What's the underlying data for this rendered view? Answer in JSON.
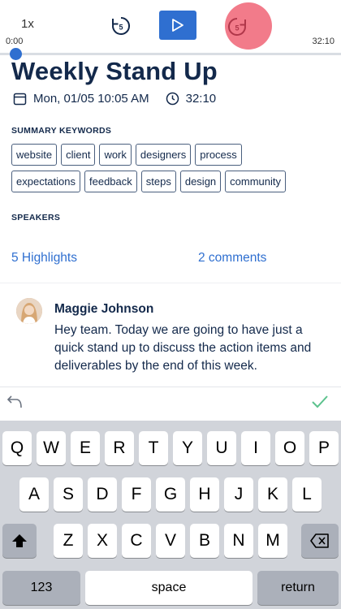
{
  "player": {
    "speed": "1x",
    "skip_back_seconds": "5",
    "skip_forward_seconds": "5",
    "current_time": "0:00",
    "total_time": "32:10",
    "progress": 0.0,
    "accent_color": "#2f6fd0",
    "highlight_color": "#f27b8a"
  },
  "meeting": {
    "title": "Weekly Stand Up",
    "date": "Mon, 01/05 10:05 AM",
    "duration": "32:10"
  },
  "keywords": {
    "label": "SUMMARY KEYWORDS",
    "row1": [
      "website",
      "client",
      "work",
      "designers",
      "process"
    ],
    "row2": [
      "expectations",
      "feedback",
      "steps",
      "design",
      "community"
    ]
  },
  "speakers": {
    "label": "SPEAKERS"
  },
  "stats": {
    "highlights": "5 Highlights",
    "comments": "2 comments"
  },
  "comment": {
    "author": "Maggie Johnson",
    "text": "Hey team. Today we are going to have just a quick stand up to discuss the action items and deliverables by the end of this week."
  },
  "keyboard": {
    "row1": [
      "Q",
      "W",
      "E",
      "R",
      "T",
      "Y",
      "U",
      "I",
      "O",
      "P"
    ],
    "row2": [
      "A",
      "S",
      "D",
      "F",
      "G",
      "H",
      "J",
      "K",
      "L"
    ],
    "row3": [
      "Z",
      "X",
      "C",
      "V",
      "B",
      "N",
      "M"
    ],
    "numbers_label": "123",
    "space_label": "space",
    "return_label": "return"
  }
}
